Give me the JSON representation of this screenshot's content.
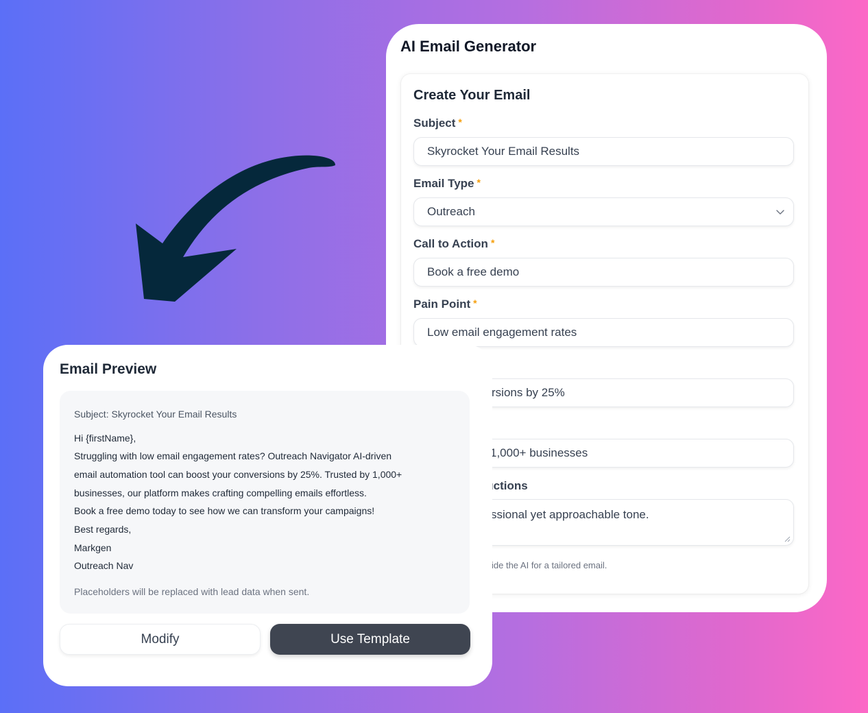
{
  "generator": {
    "title": "AI Email Generator",
    "section_title": "Create Your Email",
    "fields": {
      "subject": {
        "label": "Subject",
        "value": "Skyrocket Your Email Results"
      },
      "email_type": {
        "label": "Email Type",
        "value": "Outreach"
      },
      "call_to_action": {
        "label": "Call to Action",
        "value": "Book a free demo"
      },
      "pain_point": {
        "label": "Pain Point",
        "value": "Low email engagement rates"
      },
      "value_prop_partial": {
        "value": "rsions by 25%"
      },
      "social_proof_partial": {
        "value": "1,000+ businesses"
      },
      "instructions_partial": {
        "label": "tructions",
        "value": "ssional yet approachable tone."
      }
    },
    "helper_partial": "ide the AI for a tailored email.",
    "required_mark": "*"
  },
  "preview": {
    "title": "Email Preview",
    "subject_line": "Subject: Skyrocket Your Email Results",
    "body_lines": [
      "Hi {firstName},",
      "Struggling with low email engagement rates? Outreach Navigator AI-driven",
      "email automation tool can boost your conversions by 25%. Trusted by 1,000+",
      "businesses, our platform makes crafting compelling emails effortless.",
      "Book a free demo today to see how we can transform your campaigns!",
      "Best regards,",
      "Markgen",
      "Outreach Nav"
    ],
    "note": "Placeholders will be replaced with lead data when sent.",
    "modify_label": "Modify",
    "use_template_label": "Use Template"
  },
  "colors": {
    "gradient_start": "#5b6ff7",
    "gradient_end": "#fc68c6",
    "arrow": "#05283b",
    "primary_button": "#3f4551",
    "required": "#f59e0b"
  },
  "icons": {
    "select_chevron": "chevron-down-icon",
    "decorative_arrow": "curved-arrow-icon"
  }
}
